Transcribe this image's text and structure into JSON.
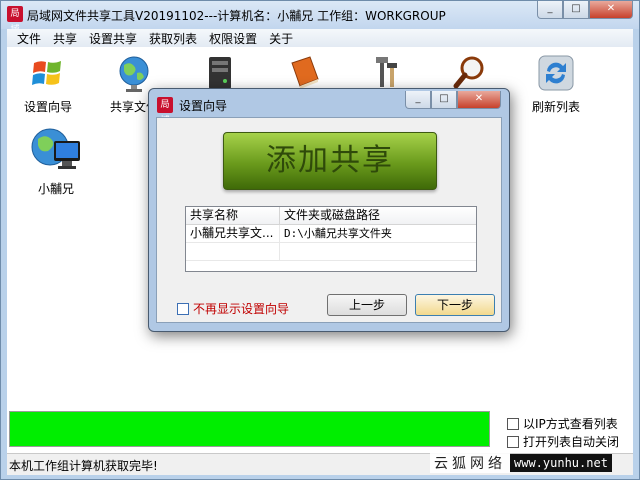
{
  "window": {
    "title": "局域网文件共享工具V20191102---计算机名：小黼兄   工作组：WORKGROUP",
    "icon_text": "局域",
    "minimize": "_",
    "maximize": "□",
    "close": "✕"
  },
  "menu": [
    "文件",
    "共享",
    "设置共享",
    "获取列表",
    "权限设置",
    "关于"
  ],
  "toolbar": [
    {
      "label": "设置向导",
      "icon": "windows-logo-icon"
    },
    {
      "label": "共享文件",
      "icon": "globe-icon"
    },
    {
      "label": "",
      "icon": "server-icon"
    },
    {
      "label": "",
      "icon": "book-icon"
    },
    {
      "label": "",
      "icon": "tools-icon"
    },
    {
      "label": "",
      "icon": "magnifier-icon"
    },
    {
      "label": "刷新列表",
      "icon": "refresh-icon"
    }
  ],
  "computers": [
    {
      "name": "小黼兄",
      "icon": "network-computer-icon"
    }
  ],
  "status": {
    "progress": 1.0,
    "message": "本机工作组计算机获取完毕!",
    "options": [
      {
        "label": "以IP方式查看列表",
        "checked": false
      },
      {
        "label": "打开列表自动关闭",
        "checked": false
      }
    ]
  },
  "dialog": {
    "title": "设置向导",
    "add_share": "添加共享",
    "columns": [
      "共享名称",
      "文件夹或磁盘路径"
    ],
    "rows": [
      {
        "name": "小黼兄共享文...",
        "path": "D:\\小黼兄共享文件夹"
      }
    ],
    "dont_show": "不再显示设置向导",
    "dont_show_checked": false,
    "prev": "上一步",
    "next": "下一步"
  },
  "watermark": {
    "text": "云狐网络",
    "url": "www.yunhu.net"
  },
  "colors": {
    "progress_fill": "#00ee00",
    "add_button": "#6a9a1c",
    "dont_show_text": "#c00000",
    "frame": "#b9d1ea"
  }
}
